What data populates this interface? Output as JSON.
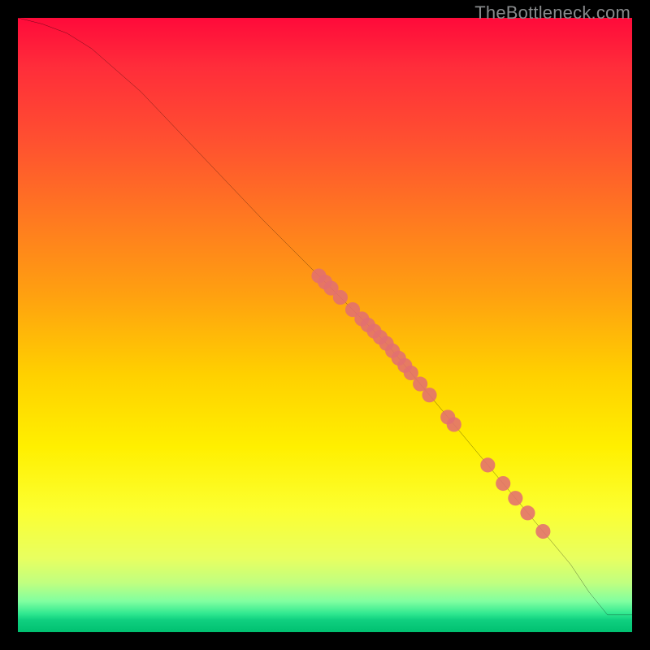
{
  "watermark": "TheBottleneck.com",
  "chart_data": {
    "type": "line",
    "title": "",
    "xlabel": "",
    "ylabel": "",
    "xlim": [
      0,
      100
    ],
    "ylim": [
      0,
      100
    ],
    "curve": {
      "x": [
        0,
        4,
        8,
        12,
        20,
        30,
        40,
        50,
        55,
        60,
        65,
        70,
        75,
        80,
        85,
        90,
        93,
        96,
        100
      ],
      "y": [
        100,
        99,
        97.5,
        95,
        88,
        77.5,
        67,
        57,
        52,
        47,
        41,
        35,
        29,
        23,
        17,
        11,
        6.5,
        2.8,
        2.8
      ]
    },
    "series": [
      {
        "name": "points",
        "color": "#e27070",
        "marker": "circle",
        "radius_norm": 1.2,
        "points": [
          {
            "x": 49,
            "y": 58.0
          },
          {
            "x": 50,
            "y": 57.0
          },
          {
            "x": 51,
            "y": 56.0
          },
          {
            "x": 52.5,
            "y": 54.5
          },
          {
            "x": 54.5,
            "y": 52.5
          },
          {
            "x": 56,
            "y": 51.0
          },
          {
            "x": 57,
            "y": 50.0
          },
          {
            "x": 58,
            "y": 49.0
          },
          {
            "x": 59,
            "y": 48.0
          },
          {
            "x": 60,
            "y": 47.0
          },
          {
            "x": 61,
            "y": 45.8
          },
          {
            "x": 62,
            "y": 44.6
          },
          {
            "x": 63,
            "y": 43.4
          },
          {
            "x": 64,
            "y": 42.2
          },
          {
            "x": 65.5,
            "y": 40.4
          },
          {
            "x": 67,
            "y": 38.6
          },
          {
            "x": 70,
            "y": 35.0
          },
          {
            "x": 71,
            "y": 33.8
          },
          {
            "x": 76.5,
            "y": 27.2
          },
          {
            "x": 79,
            "y": 24.2
          },
          {
            "x": 81,
            "y": 21.8
          },
          {
            "x": 83,
            "y": 19.4
          },
          {
            "x": 85.5,
            "y": 16.4
          }
        ]
      }
    ]
  }
}
